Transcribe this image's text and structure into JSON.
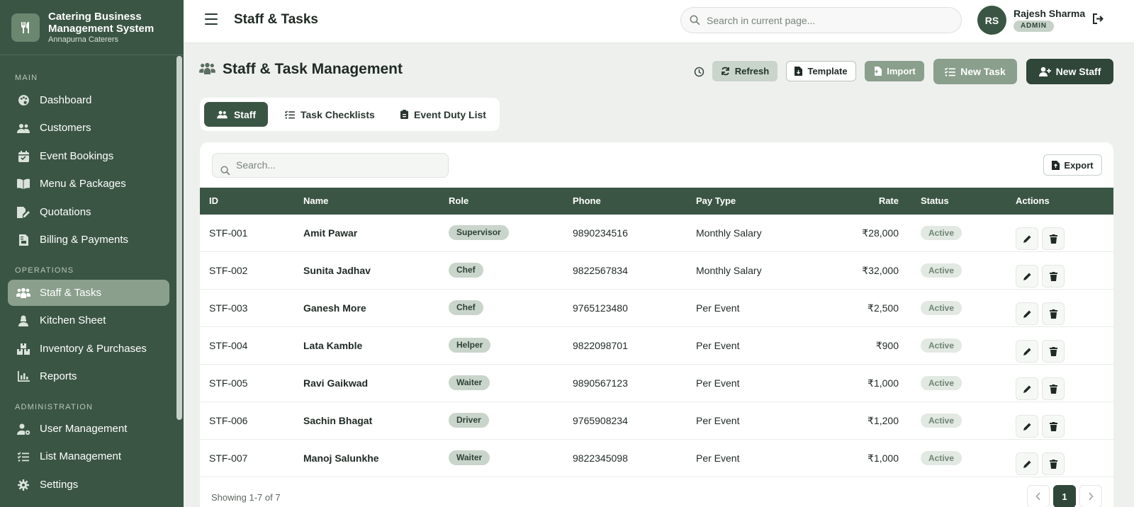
{
  "app": {
    "title": "Catering Business Management System",
    "company": "Annapurna Caterers"
  },
  "sidebar": {
    "sections": [
      {
        "label": "MAIN"
      },
      {
        "label": "OPERATIONS"
      },
      {
        "label": "ADMINISTRATION"
      }
    ],
    "items": [
      {
        "label": "Dashboard",
        "icon": "palette-icon"
      },
      {
        "label": "Customers",
        "icon": "users-icon"
      },
      {
        "label": "Event Bookings",
        "icon": "calendar-check-icon"
      },
      {
        "label": "Menu & Packages",
        "icon": "book-open-icon"
      },
      {
        "label": "Quotations",
        "icon": "file-signature-icon"
      },
      {
        "label": "Billing & Payments",
        "icon": "invoice-icon"
      },
      {
        "label": "Staff & Tasks",
        "icon": "people-group-icon",
        "active": true
      },
      {
        "label": "Kitchen Sheet",
        "icon": "cook-icon"
      },
      {
        "label": "Inventory & Purchases",
        "icon": "boxes-icon"
      },
      {
        "label": "Reports",
        "icon": "bar-chart-icon"
      },
      {
        "label": "User Management",
        "icon": "user-gear-icon"
      },
      {
        "label": "List Management",
        "icon": "list-check-icon"
      },
      {
        "label": "Settings",
        "icon": "gear-icon"
      }
    ]
  },
  "header": {
    "title": "Staff & Tasks",
    "search_placeholder": "Search in current page...",
    "user": {
      "initials": "RS",
      "name": "Rajesh Sharma",
      "role": "ADMIN"
    }
  },
  "page": {
    "title": "Staff & Task Management",
    "actions": {
      "refresh": "Refresh",
      "template": "Template",
      "import": "Import",
      "new_task": "New Task",
      "new_staff": "New Staff"
    },
    "tabs": [
      {
        "label": "Staff",
        "active": true
      },
      {
        "label": "Task Checklists"
      },
      {
        "label": "Event Duty List"
      }
    ]
  },
  "table": {
    "search_placeholder": "Search...",
    "export_label": "Export",
    "columns": [
      "ID",
      "Name",
      "Role",
      "Phone",
      "Pay Type",
      "Rate",
      "Status",
      "Actions"
    ],
    "rows": [
      {
        "id": "STF-001",
        "name": "Amit Pawar",
        "role": "Supervisor",
        "phone": "9890234516",
        "pay_type": "Monthly Salary",
        "rate": "₹28,000",
        "status": "Active"
      },
      {
        "id": "STF-002",
        "name": "Sunita Jadhav",
        "role": "Chef",
        "phone": "9822567834",
        "pay_type": "Monthly Salary",
        "rate": "₹32,000",
        "status": "Active"
      },
      {
        "id": "STF-003",
        "name": "Ganesh More",
        "role": "Chef",
        "phone": "9765123480",
        "pay_type": "Per Event",
        "rate": "₹2,500",
        "status": "Active"
      },
      {
        "id": "STF-004",
        "name": "Lata Kamble",
        "role": "Helper",
        "phone": "9822098701",
        "pay_type": "Per Event",
        "rate": "₹900",
        "status": "Active"
      },
      {
        "id": "STF-005",
        "name": "Ravi Gaikwad",
        "role": "Waiter",
        "phone": "9890567123",
        "pay_type": "Per Event",
        "rate": "₹1,000",
        "status": "Active"
      },
      {
        "id": "STF-006",
        "name": "Sachin Bhagat",
        "role": "Driver",
        "phone": "9765908234",
        "pay_type": "Per Event",
        "rate": "₹1,200",
        "status": "Active"
      },
      {
        "id": "STF-007",
        "name": "Manoj Salunkhe",
        "role": "Waiter",
        "phone": "9822345098",
        "pay_type": "Per Event",
        "rate": "₹1,000",
        "status": "Active"
      }
    ],
    "footer": "Showing 1-7 of 7",
    "current_page": "1"
  },
  "colors": {
    "brand": "#3b5544",
    "active_nav": "#8a9f8c",
    "badge_role": "#c9d4ca",
    "badge_status": "#e2e8e2"
  }
}
